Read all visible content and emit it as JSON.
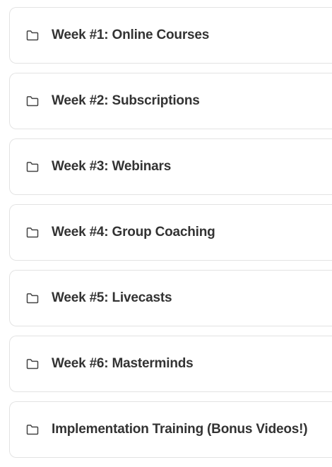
{
  "modules": [
    {
      "title": "Week #1: Online Courses",
      "icon": "folder-icon"
    },
    {
      "title": "Week #2: Subscriptions",
      "icon": "folder-icon"
    },
    {
      "title": "Week #3: Webinars",
      "icon": "folder-icon"
    },
    {
      "title": "Week #4: Group Coaching",
      "icon": "folder-icon"
    },
    {
      "title": "Week #5: Livecasts",
      "icon": "folder-icon"
    },
    {
      "title": "Week #6: Masterminds",
      "icon": "folder-icon"
    },
    {
      "title": "Implementation Training (Bonus Videos!)",
      "icon": "folder-icon"
    }
  ],
  "colors": {
    "text": "#333333",
    "border": "#e3e3e3",
    "icon": "#444444",
    "background": "#ffffff"
  }
}
